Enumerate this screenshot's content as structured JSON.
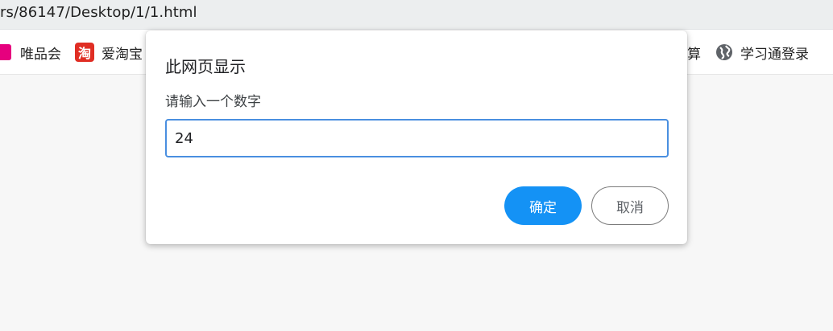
{
  "browser": {
    "url": "rs/86147/Desktop/1/1.html"
  },
  "bookmarks": [
    {
      "label": "唯品会",
      "icon": "vipshop-icon",
      "color": "#e6007e"
    },
    {
      "label": "爱淘宝",
      "icon": "taobao-icon",
      "glyph": "淘",
      "color": "#e02e24"
    },
    {
      "label": "算",
      "icon": "none"
    },
    {
      "label": "学习通登录",
      "icon": "globe-icon",
      "color": "#5f6368"
    }
  ],
  "dialog": {
    "title": "此网页显示",
    "message": "请输入一个数字",
    "input_value": "24",
    "ok_label": "确定",
    "cancel_label": "取消",
    "accent_color": "#1492f5",
    "focus_color": "#4a8fe0"
  }
}
